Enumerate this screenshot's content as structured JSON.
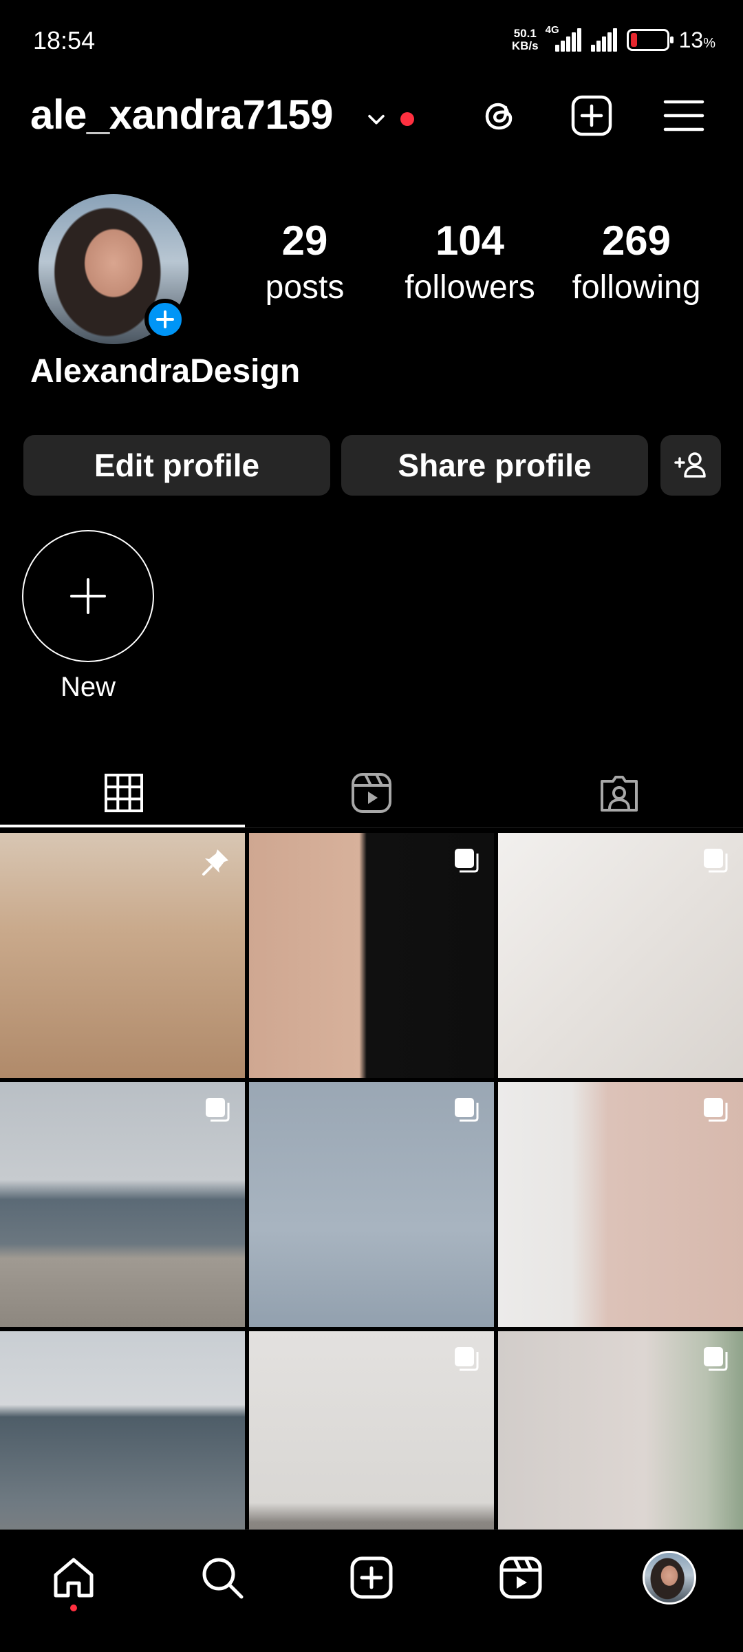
{
  "status_bar": {
    "time": "18:54",
    "net_speed_value": "50.1",
    "net_speed_unit": "KB/s",
    "network_type": "4G",
    "battery_percent": "13",
    "battery_symbol": "%",
    "battery_level": 0.13,
    "battery_color": "#e5272e"
  },
  "header": {
    "username": "ale_xandra7159",
    "icons": [
      "chevron-down-icon",
      "notification-dot",
      "threads-icon",
      "create-icon",
      "menu-icon"
    ]
  },
  "profile": {
    "display_name": "AlexandraDesign",
    "stats": [
      {
        "value": "29",
        "label": "posts"
      },
      {
        "value": "104",
        "label": "followers"
      },
      {
        "value": "269",
        "label": "following"
      }
    ]
  },
  "buttons": {
    "edit_label": "Edit profile",
    "share_label": "Share profile",
    "discover_icon": "add-person-icon"
  },
  "highlights": {
    "new_label": "New"
  },
  "tabs": [
    {
      "icon": "grid-icon",
      "active": true
    },
    {
      "icon": "reels-icon",
      "active": false
    },
    {
      "icon": "tagged-icon",
      "active": false
    }
  ],
  "posts": [
    {
      "badge": "pin-icon"
    },
    {
      "badge": "carousel-icon"
    },
    {
      "badge": "carousel-icon"
    },
    {
      "badge": "carousel-icon"
    },
    {
      "badge": "carousel-icon"
    },
    {
      "badge": "carousel-icon"
    },
    {
      "badge": ""
    },
    {
      "badge": "carousel-icon"
    },
    {
      "badge": "carousel-icon"
    }
  ],
  "bottom_nav": [
    {
      "icon": "home-icon",
      "active": true
    },
    {
      "icon": "search-icon"
    },
    {
      "icon": "create-icon"
    },
    {
      "icon": "reels-icon"
    },
    {
      "icon": "profile-avatar"
    }
  ],
  "colors": {
    "background": "#000000",
    "button_bg": "#262626",
    "accent_blue": "#0095f6",
    "notification_red": "#ff3040"
  }
}
